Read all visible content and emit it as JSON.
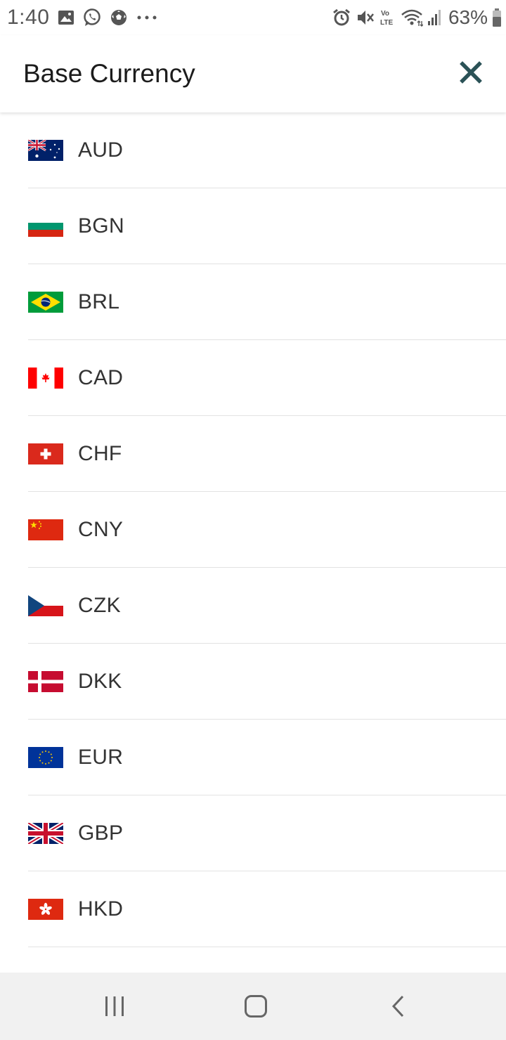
{
  "status_bar": {
    "time": "1:40",
    "battery_percent": "63%",
    "left_icons": [
      "image-icon",
      "whatsapp-icon",
      "soccer-ball-icon",
      "more-dots-icon"
    ],
    "right_icons": [
      "alarm-icon",
      "mute-icon",
      "volte-icon",
      "wifi-icon",
      "signal-icon",
      "battery-icon"
    ],
    "volte_label": "Vo\nLTE"
  },
  "header": {
    "title": "Base Currency",
    "close_icon": "close-icon",
    "accent_color": "#2b5257"
  },
  "currencies": [
    {
      "code": "AUD",
      "flag": "australia-flag-icon"
    },
    {
      "code": "BGN",
      "flag": "bulgaria-flag-icon"
    },
    {
      "code": "BRL",
      "flag": "brazil-flag-icon"
    },
    {
      "code": "CAD",
      "flag": "canada-flag-icon"
    },
    {
      "code": "CHF",
      "flag": "switzerland-flag-icon"
    },
    {
      "code": "CNY",
      "flag": "china-flag-icon"
    },
    {
      "code": "CZK",
      "flag": "czech-flag-icon"
    },
    {
      "code": "DKK",
      "flag": "denmark-flag-icon"
    },
    {
      "code": "EUR",
      "flag": "eu-flag-icon"
    },
    {
      "code": "GBP",
      "flag": "uk-flag-icon"
    },
    {
      "code": "HKD",
      "flag": "hong-kong-flag-icon"
    }
  ],
  "nav_bar": {
    "recents_icon": "recents-icon",
    "home_icon": "home-icon",
    "back_icon": "back-icon"
  }
}
